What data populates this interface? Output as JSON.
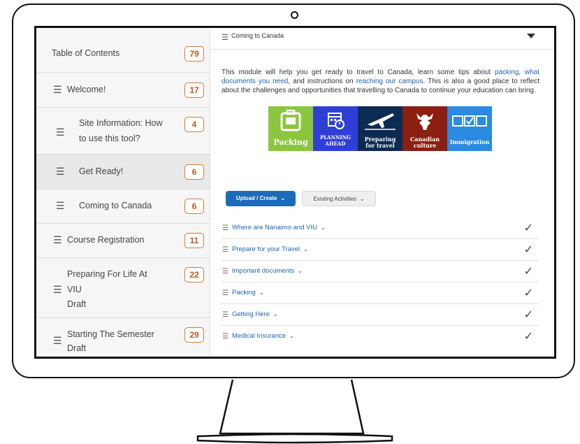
{
  "sidebar": {
    "items": [
      {
        "label": "Table of Contents",
        "count": "79"
      },
      {
        "label": "Welcome!",
        "count": "17"
      },
      {
        "label_line1": "Site Information: How",
        "label_line2": "to use this tool?",
        "count": "4"
      },
      {
        "label": "Get Ready!",
        "count": "6"
      },
      {
        "label": "Coming to Canada",
        "count": "6"
      },
      {
        "label": "Course Registration",
        "count": "11"
      },
      {
        "label_line1": "Preparing For Life At",
        "label_line2": "VIU",
        "status": "Draft",
        "count": "22"
      },
      {
        "label": "Starting The Semester",
        "status": "Draft",
        "count": "29"
      }
    ]
  },
  "module": {
    "title": "Coming to Canada",
    "intro": {
      "t1": "This module will help you get ready to travel to Canada, learn some tips about ",
      "l1": "packing",
      "t2": ", ",
      "l2": "what documents you need",
      "t3": ", and instructions on ",
      "l3": "reaching our campus",
      "t4": ". This is also a good place to reflect about the challenges and opportunities that travelling to Canada to continue your education can bring."
    },
    "tiles": [
      {
        "label": "Packing",
        "color": "#8cc63f",
        "icon": "suitcase-icon"
      },
      {
        "label": "PLANNING AHEAD",
        "color": "#2f3fd6",
        "icon": "calendar-icon"
      },
      {
        "label": "Preparing for travel",
        "color": "#0d2b52",
        "icon": "airplane-icon"
      },
      {
        "label": "Canadian culture",
        "color": "#8a1f12",
        "icon": "moose-icon"
      },
      {
        "label": "Immigration",
        "color": "#2b8ae2",
        "icon": "checkbox-icon"
      }
    ],
    "buttons": {
      "upload": "Upload / Create",
      "existing": "Existing Activities"
    },
    "activities": [
      "Where are Nanaimo and VIU",
      "Prepare for your Travel",
      "Important documents",
      "Packing",
      "Getting Here",
      "Medical Insurance"
    ]
  }
}
